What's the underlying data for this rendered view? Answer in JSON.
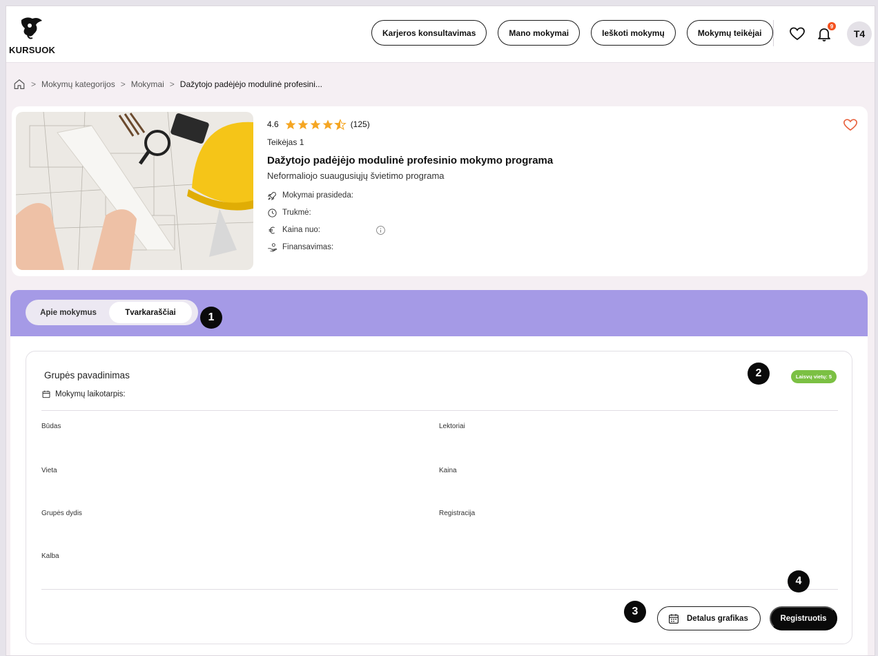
{
  "header": {
    "logo_text": "KURSUOK",
    "nav": [
      "Karjeros konsultavimas",
      "Mano mokymai",
      "Ieškoti mokymų",
      "Mokymų teikėjai"
    ],
    "notifications_count": "9",
    "avatar_initials": "T4"
  },
  "breadcrumb": {
    "items": [
      "Mokymų kategorijos",
      "Mokymai",
      "Dažytojo padėjėjo modulinė profesini..."
    ]
  },
  "course": {
    "rating": "4.6",
    "rating_stars": 4.5,
    "reviews": "(125)",
    "provider": "Teikėjas 1",
    "title": "Dažytojo padėjėjo modulinė profesinio mokymo programa",
    "subtitle": "Neformaliojo suaugusiųjų švietimo programa",
    "meta": {
      "start": "Mokymai prasideda:",
      "duration": "Trukmė:",
      "price": "Kaina nuo:",
      "funding": "Finansavimas:"
    }
  },
  "tabs": [
    "Apie mokymus",
    "Tvarkaraščiai"
  ],
  "active_tab": "Tvarkaraščiai",
  "annotations": [
    "1",
    "2",
    "3",
    "4"
  ],
  "group": {
    "name_label": "Grupės pavadinimas",
    "period_label": "Mokymų laikotarpis:",
    "free_seats": "Laisvų vietų: 5",
    "fields_left": [
      "Būdas",
      "Vieta",
      "Grupės dydis",
      "Kalba"
    ],
    "fields_right": [
      "Lektoriai",
      "Kaina",
      "Registracija"
    ],
    "detail_button": "Detalus grafikas",
    "register_button": "Registruotis"
  },
  "colors": {
    "tabbar": "#a59ae6",
    "badge_green": "#7bc043",
    "heart": "#e8603c",
    "star": "#f5a623",
    "notification": "#f4511e"
  }
}
